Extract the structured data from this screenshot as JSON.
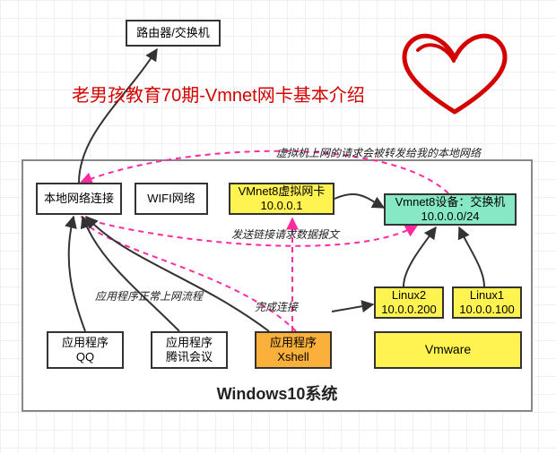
{
  "title": "老男孩教育70期-Vmnet网卡基本介绍",
  "outer_label": "Windows10系统",
  "nodes": {
    "router": "路由器/交换机",
    "lan": "本地网络连接",
    "wifi": "WIFI网络",
    "vmnet8_nic_line1": "VMnet8虚拟网卡",
    "vmnet8_nic_line2": "10.0.0.1",
    "vmnet8_sw_line1": "Vmnet8设备：交换机",
    "vmnet8_sw_line2": "10.0.0.0/24",
    "linux2_line1": "Linux2",
    "linux2_line2": "10.0.0.200",
    "linux1_line1": "Linux1",
    "linux1_line2": "10.0.0.100",
    "vmware": "Vmware",
    "app_qq_line1": "应用程序",
    "app_qq_line2": "QQ",
    "app_tencent_line1": "应用程序",
    "app_tencent_line2": "腾讯会议",
    "app_xshell_line1": "应用程序",
    "app_xshell_line2": "Xshell"
  },
  "annotations": {
    "forward": "虚拟机上网的请求会被转发给我的本地网络",
    "send_req": "发送链接请求数据报文",
    "complete": "完成连接",
    "normal_flow": "应用程序正常上网流程"
  }
}
